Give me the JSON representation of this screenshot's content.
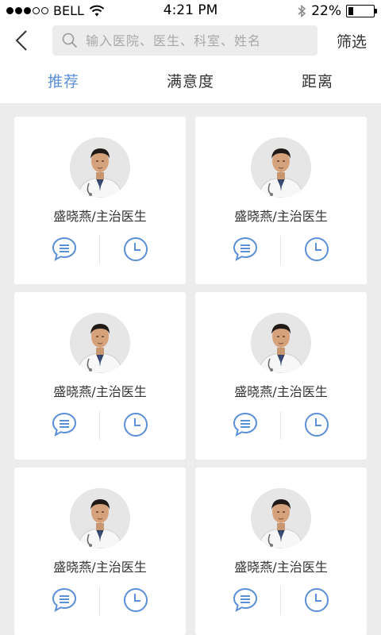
{
  "status_bar": {
    "carrier": "BELL",
    "time": "4:21 PM",
    "battery_percent_label": "22%",
    "battery_level": 0.22,
    "signal_dots_filled": 3,
    "signal_dots_total": 5
  },
  "nav": {
    "search_placeholder": "输入医院、医生、科室、姓名",
    "filter_label": "筛选"
  },
  "tabs": [
    {
      "label": "推荐",
      "active": true
    },
    {
      "label": "满意度",
      "active": false
    },
    {
      "label": "距离",
      "active": false
    }
  ],
  "doctors": [
    {
      "name": "盛晓燕/主治医生"
    },
    {
      "name": "盛晓燕/主治医生"
    },
    {
      "name": "盛晓燕/主治医生"
    },
    {
      "name": "盛晓燕/主治医生"
    },
    {
      "name": "盛晓燕/主治医生"
    },
    {
      "name": "盛晓燕/主治医生"
    }
  ],
  "colors": {
    "accent": "#5b8fd8",
    "background": "#ececec",
    "card": "#ffffff"
  },
  "icons": {
    "chat": "chat-bubble-icon",
    "clock": "clock-icon"
  }
}
